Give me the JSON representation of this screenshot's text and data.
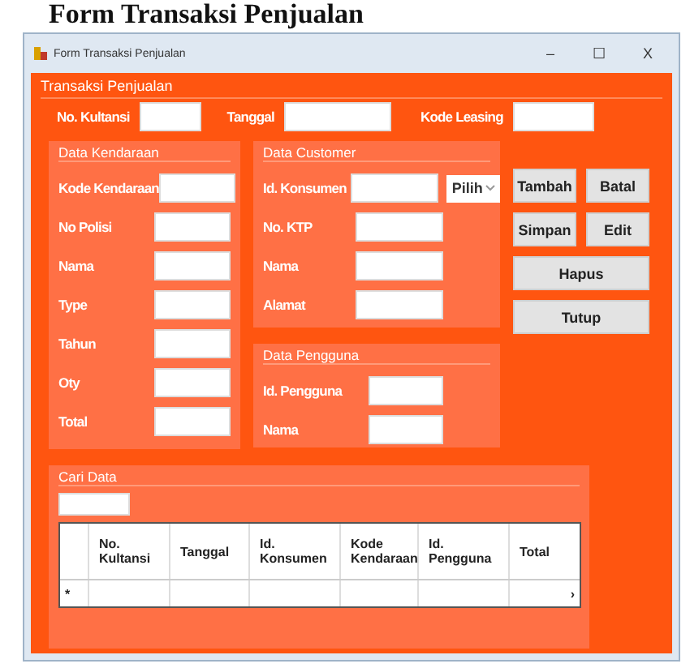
{
  "page_heading": "Form Transaksi Penjualan",
  "window": {
    "title": "Form Transaksi Penjualan",
    "controls": [
      "–",
      "☐",
      "X"
    ]
  },
  "transaksi": {
    "title": "Transaksi Penjualan",
    "fields": [
      {
        "label": "No. Kultansi"
      },
      {
        "label": "Tanggal"
      },
      {
        "label": "Kode Leasing"
      }
    ]
  },
  "data_kendaraan": {
    "title": "Data Kendaraan",
    "fields": [
      {
        "label": "Kode Kendaraan"
      },
      {
        "label": "No Polisi"
      },
      {
        "label": "Nama"
      },
      {
        "label": "Type"
      },
      {
        "label": "Tahun"
      },
      {
        "label": "Oty"
      },
      {
        "label": "Total"
      }
    ]
  },
  "data_customer": {
    "title": "Data Customer",
    "fields": [
      {
        "label": "Id. Konsumen"
      },
      {
        "label": "No. KTP"
      },
      {
        "label": "Nama"
      },
      {
        "label": "Alamat"
      }
    ],
    "dropdown": "Pilih"
  },
  "data_pengguna": {
    "title": "Data Pengguna",
    "fields": [
      {
        "label": "Id. Pengguna"
      },
      {
        "label": "Nama"
      }
    ]
  },
  "buttons": [
    {
      "label": "Tambah",
      "kind": "half"
    },
    {
      "label": "Batal",
      "kind": "half"
    },
    {
      "label": "Simpan",
      "kind": "half"
    },
    {
      "label": "Edit",
      "kind": "half"
    },
    {
      "label": "Hapus",
      "kind": "full"
    },
    {
      "label": "Tutup",
      "kind": "full"
    }
  ],
  "cari_data": {
    "title": "Cari Data",
    "table": {
      "columns": [
        "No. Kultansi",
        "Tanggal",
        "Id. Konsumen",
        "Kode Kendaraan",
        "Id. Pengguna",
        "Total"
      ],
      "new_row_marker": "*",
      "scroll_arrow": "›"
    }
  }
}
